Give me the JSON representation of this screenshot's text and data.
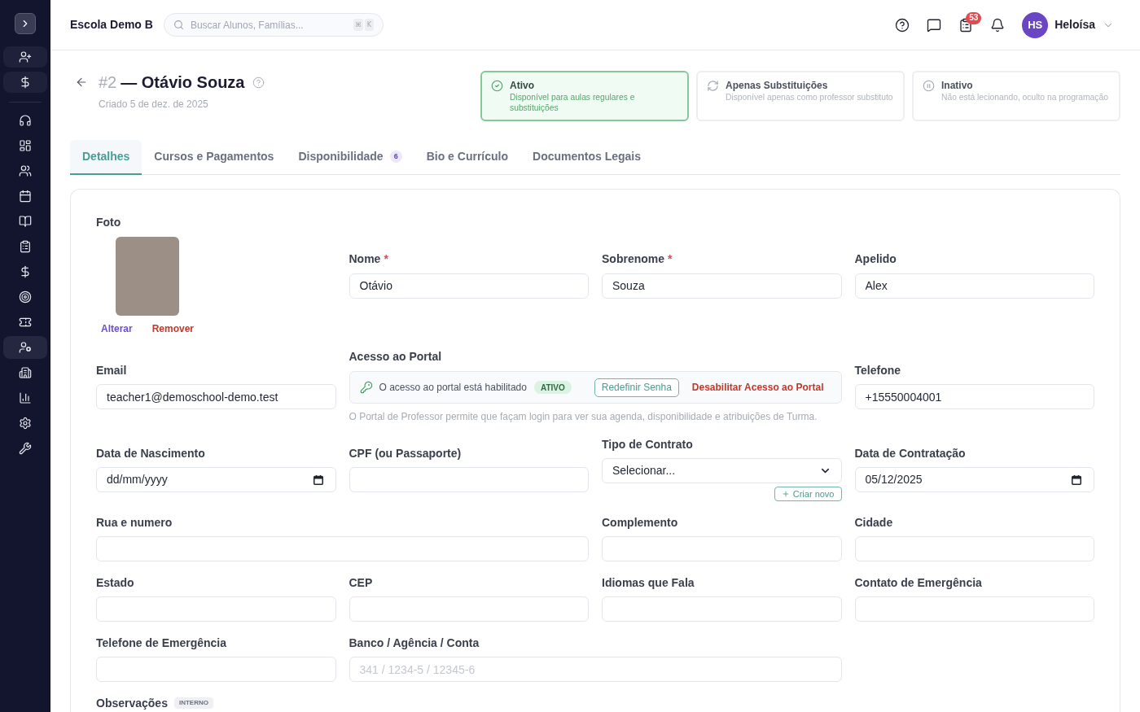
{
  "sidebar": {
    "quick_actions": [
      {
        "kind": "add-person"
      },
      {
        "kind": "money"
      }
    ],
    "items": [
      {
        "kind": "support",
        "selected": false
      },
      {
        "kind": "dashboard",
        "selected": false
      },
      {
        "kind": "people",
        "selected": false
      },
      {
        "kind": "calendar",
        "selected": false
      },
      {
        "kind": "book",
        "selected": false
      },
      {
        "kind": "clipboard",
        "selected": false
      },
      {
        "kind": "money",
        "selected": false
      },
      {
        "kind": "target",
        "selected": false
      },
      {
        "kind": "ticket",
        "selected": false
      },
      {
        "kind": "teacher-settings",
        "selected": true
      },
      {
        "kind": "building",
        "selected": false
      },
      {
        "kind": "chart",
        "selected": false
      },
      {
        "kind": "settings",
        "selected": false
      },
      {
        "kind": "tools",
        "selected": false
      }
    ]
  },
  "header": {
    "school": "Escola Demo B",
    "search": {
      "placeholder": "Buscar Alunos, Famílias...",
      "shortcut": [
        "⌘",
        "K"
      ]
    },
    "actions": [
      {
        "kind": "help"
      },
      {
        "kind": "messages"
      },
      {
        "kind": "tasks",
        "badge": "53"
      },
      {
        "kind": "notifications"
      }
    ],
    "user": {
      "initials": "HS",
      "name": "Heloísa"
    }
  },
  "page": {
    "number": "#2",
    "title": "— Otávio Souza",
    "created": "Criado 5 de dez. de 2025",
    "status_options": [
      {
        "kind": "active",
        "title": "Ativo",
        "description": "Disponível para aulas regulares e substituições",
        "selected": true
      },
      {
        "kind": "substitute",
        "title": "Apenas Substituições",
        "description": "Disponível apenas como professor substituto",
        "selected": false
      },
      {
        "kind": "inactive",
        "title": "Inativo",
        "description": "Não está lecionando, oculto na programação",
        "selected": false
      }
    ],
    "tabs": [
      {
        "label": "Detalhes",
        "selected": true
      },
      {
        "label": "Cursos e Pagamentos",
        "selected": false
      },
      {
        "label": "Disponibilidade",
        "badge": "6",
        "selected": false
      },
      {
        "label": "Bio e Currículo",
        "selected": false
      },
      {
        "label": "Documentos Legais",
        "selected": false
      }
    ]
  },
  "form": {
    "rows": [
      [
        {
          "kind": "photo",
          "label": "Foto",
          "change": "Alterar",
          "remove": "Remover"
        },
        {
          "kind": "text",
          "label": "Nome",
          "required_mark": "*",
          "value": "Otávio"
        },
        {
          "kind": "text",
          "label": "Sobrenome",
          "required_mark": "*",
          "value": "Souza"
        },
        {
          "kind": "text",
          "label": "Apelido",
          "value": "Alex"
        }
      ],
      [
        {
          "kind": "text",
          "label": "Email",
          "value": "teacher1@demoschool-demo.test"
        },
        {
          "kind": "portal",
          "label": "Acesso ao Portal",
          "status_text": "O acesso ao portal está habilitado",
          "status_badge": "ATIVO",
          "reset_button": "Redefinir Senha",
          "disable_link": "Desabilitar Acesso ao Portal",
          "help": "O Portal de Professor permite que façam login para ver sua agenda, disponibilidade e atribuições de Turma."
        },
        {
          "kind": "text",
          "label": "Telefone",
          "value": "+15550004001"
        }
      ],
      [
        {
          "kind": "date",
          "label": "Data de Nascimento",
          "placeholder": "dd/mm/yyyy"
        },
        {
          "kind": "text",
          "label": "CPF (ou Passaporte)"
        },
        {
          "kind": "select",
          "label": "Tipo de Contrato",
          "value": "Selecionar...",
          "create_button": "Criar novo"
        },
        {
          "kind": "date",
          "label": "Data de Contratação",
          "value": "05/12/2025"
        }
      ],
      [
        {
          "kind": "text",
          "label": "Rua e numero"
        },
        {
          "kind": "text",
          "label": "Complemento"
        },
        {
          "kind": "text",
          "label": "Cidade"
        }
      ],
      [
        {
          "kind": "text",
          "label": "Estado"
        },
        {
          "kind": "text",
          "label": "CEP"
        },
        {
          "kind": "text",
          "label": "Idiomas que Fala"
        },
        {
          "kind": "text",
          "label": "Contato de Emergência"
        }
      ],
      [
        {
          "kind": "text",
          "label": "Telefone de Emergência"
        },
        {
          "kind": "text",
          "label": "Banco / Agência / Conta",
          "placeholder": "341 / 1234-5 / 12345-6"
        }
      ],
      [
        {
          "kind": "notes",
          "label": "Observações",
          "badge": "INTERNO"
        }
      ]
    ]
  }
}
